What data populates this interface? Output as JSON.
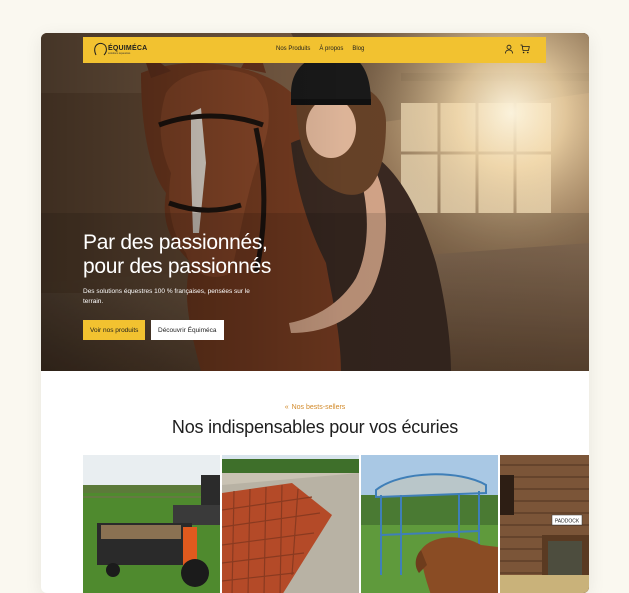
{
  "brand": {
    "name": "ÉQUIMÉCA",
    "tagline": "solutions équestres",
    "accent": "#f2c230"
  },
  "nav": {
    "links": [
      "Nos Produits",
      "À propos",
      "Blog"
    ],
    "icons": [
      "user-icon",
      "cart-icon"
    ]
  },
  "hero": {
    "title_line1": "Par des passionnés,",
    "title_line2": "pour des passionnés",
    "subtitle": "Des solutions équestres 100 % françaises, pensées sur le terrain.",
    "cta_primary": "Voir nos produits",
    "cta_secondary": "Découvrir Équiméca"
  },
  "bestsellers": {
    "eyebrow_icon": "«",
    "eyebrow": "Nos bests-sellers",
    "title": "Nos indispensables pour vos écuries",
    "products": [
      {
        "image": "spreader-machine-image"
      },
      {
        "image": "ground-grid-image"
      },
      {
        "image": "hay-feeder-image"
      },
      {
        "image": "paddock-stable-image",
        "sign": "PADDOCK"
      }
    ]
  }
}
